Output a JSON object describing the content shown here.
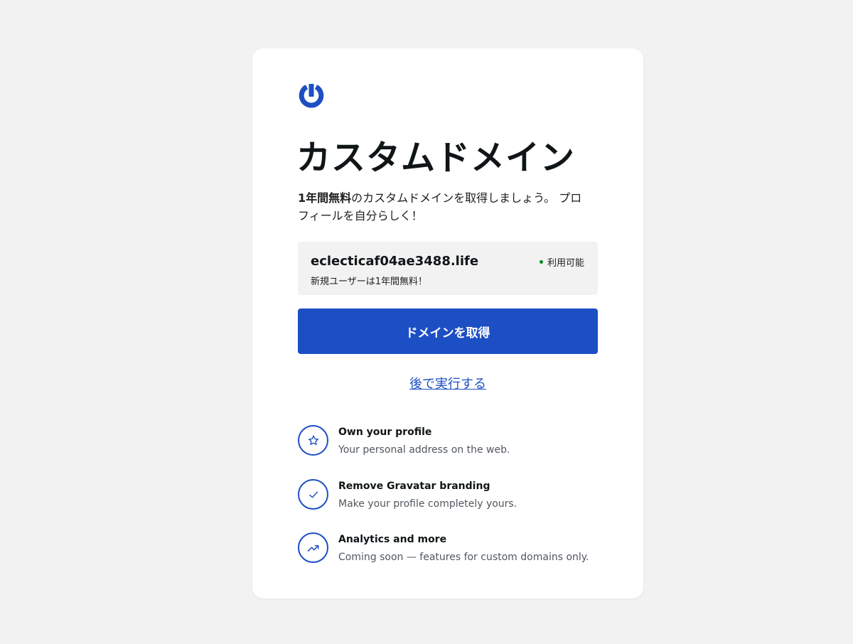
{
  "page": {
    "title": "カスタムドメイン",
    "description_bold": "1年間無料",
    "description_rest": "のカスタムドメインを取得しましょう。 プロフィールを自分らしく！"
  },
  "domain": {
    "name": "eclecticaf04ae3488.life",
    "subtitle": "新規ユーザーは1年間無料！",
    "status": "利用可能",
    "status_color": "#008a20"
  },
  "actions": {
    "primary_label": "ドメインを取得",
    "secondary_label": "後で実行する"
  },
  "features": [
    {
      "icon": "star-icon",
      "title": "Own your profile",
      "description": "Your personal address on the web."
    },
    {
      "icon": "check-icon",
      "title": "Remove Gravatar branding",
      "description": "Make your profile completely yours."
    },
    {
      "icon": "trending-up-icon",
      "title": "Analytics and more",
      "description": "Coming soon — features for custom domains only."
    }
  ],
  "colors": {
    "accent": "#1d4fc4",
    "background": "#f2f2f2",
    "card": "#ffffff"
  }
}
